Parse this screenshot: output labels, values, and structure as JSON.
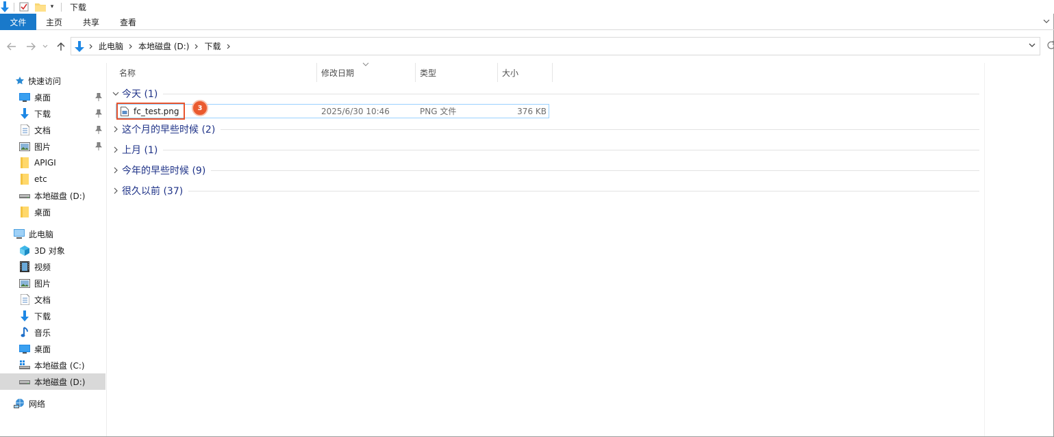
{
  "window": {
    "title": "下载"
  },
  "ribbon": {
    "tabs": [
      "文件",
      "主页",
      "共享",
      "查看"
    ]
  },
  "address": {
    "crumbs": [
      "此电脑",
      "本地磁盘 (D:)",
      "下载"
    ]
  },
  "sidebar": {
    "quick_access": "快速访问",
    "quick_items": [
      "桌面",
      "下载",
      "文档",
      "图片",
      "APIGI",
      "etc",
      "本地磁盘 (D:)",
      "桌面"
    ],
    "this_pc": "此电脑",
    "pc_items": [
      "3D 对象",
      "视频",
      "图片",
      "文档",
      "下载",
      "音乐",
      "桌面",
      "本地磁盘 (C:)",
      "本地磁盘 (D:)"
    ],
    "network": "网络"
  },
  "columns": {
    "name": "名称",
    "date": "修改日期",
    "type": "类型",
    "size": "大小"
  },
  "groups": [
    "今天 (1)",
    "这个月的早些时候 (2)",
    "上月 (1)",
    "今年的早些时候 (9)",
    "很久以前 (37)"
  ],
  "file": {
    "name": "fc_test.png",
    "date": "2025/6/30 10:46",
    "type": "PNG 文件",
    "size": "376 KB"
  },
  "annotation": {
    "badge": "3"
  },
  "colors": {
    "accent": "#1979ca",
    "group_text": "#1e3287",
    "highlight": "#e8542d",
    "selection": "#99d1ff"
  }
}
